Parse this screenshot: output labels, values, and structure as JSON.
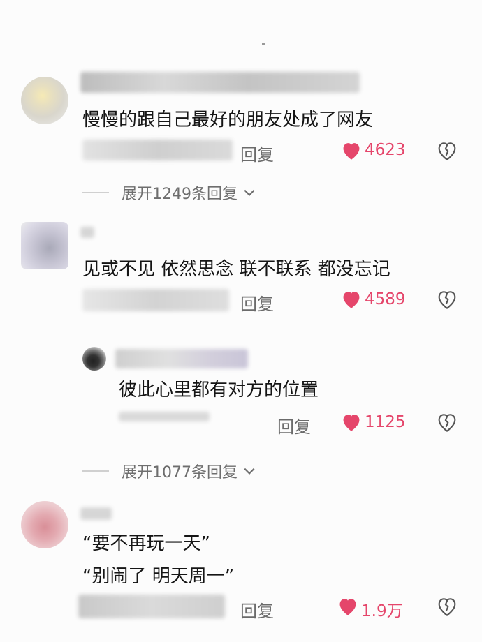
{
  "comments": [
    {
      "text": [
        "慢慢的跟自己最好的朋友处成了网友"
      ],
      "reply_label": "回复",
      "likes": "4623",
      "expand_label": "展开1249条回复"
    },
    {
      "text": [
        "见或不见 依然思念 联不联系 都没忘记"
      ],
      "reply_label": "回复",
      "likes": "4589",
      "sub_reply": {
        "text": "彼此心里都有对方的位置",
        "reply_label": "回复",
        "likes": "1125"
      },
      "expand_label": "展开1077条回复"
    },
    {
      "text": [
        "“要不再玩一天”",
        "“别闹了 明天周一”"
      ],
      "reply_label": "回复",
      "likes": "1.9万"
    }
  ],
  "colors": {
    "like": "#e5466b",
    "secondary_text": "#6e6e6e"
  },
  "icons": [
    "heart-icon",
    "broken-heart-icon",
    "chevron-down-icon"
  ]
}
